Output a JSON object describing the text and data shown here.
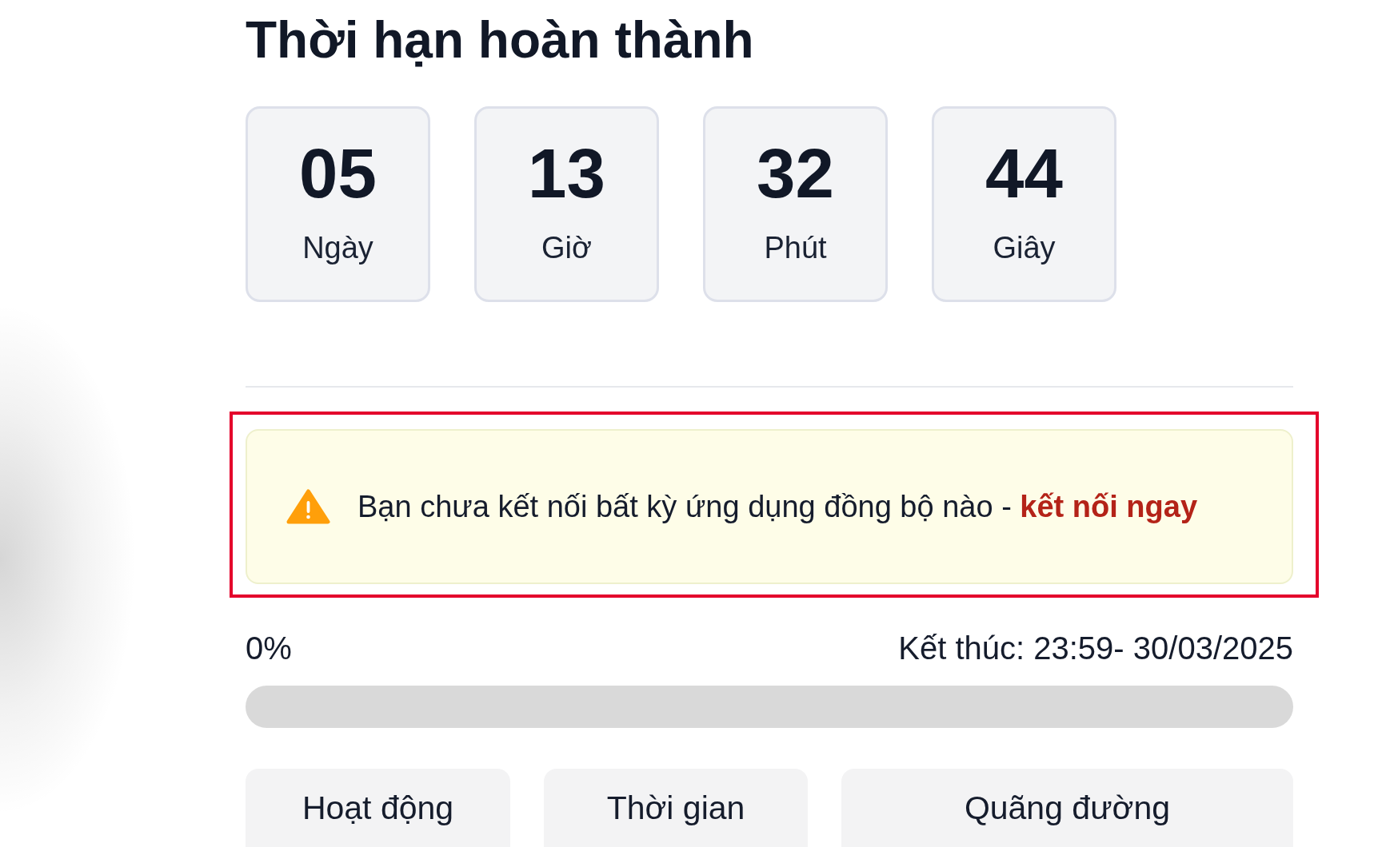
{
  "title": "Thời hạn hoàn thành",
  "countdown": [
    {
      "value": "05",
      "unit": "Ngày"
    },
    {
      "value": "13",
      "unit": "Giờ"
    },
    {
      "value": "32",
      "unit": "Phút"
    },
    {
      "value": "44",
      "unit": "Giây"
    }
  ],
  "alert": {
    "highlighted": true,
    "message": "Bạn chưa kết nối bất kỳ ứng dụng đồng bộ nào -",
    "link": "kết nối ngay"
  },
  "progress": {
    "percent_label": "0%",
    "end_label": "Kết thúc: 23:59- 30/03/2025",
    "level": 0
  },
  "stat_cards": [
    {
      "label": "Hoạt động"
    },
    {
      "label": "Thời gian"
    },
    {
      "label": "Quãng đường"
    }
  ]
}
